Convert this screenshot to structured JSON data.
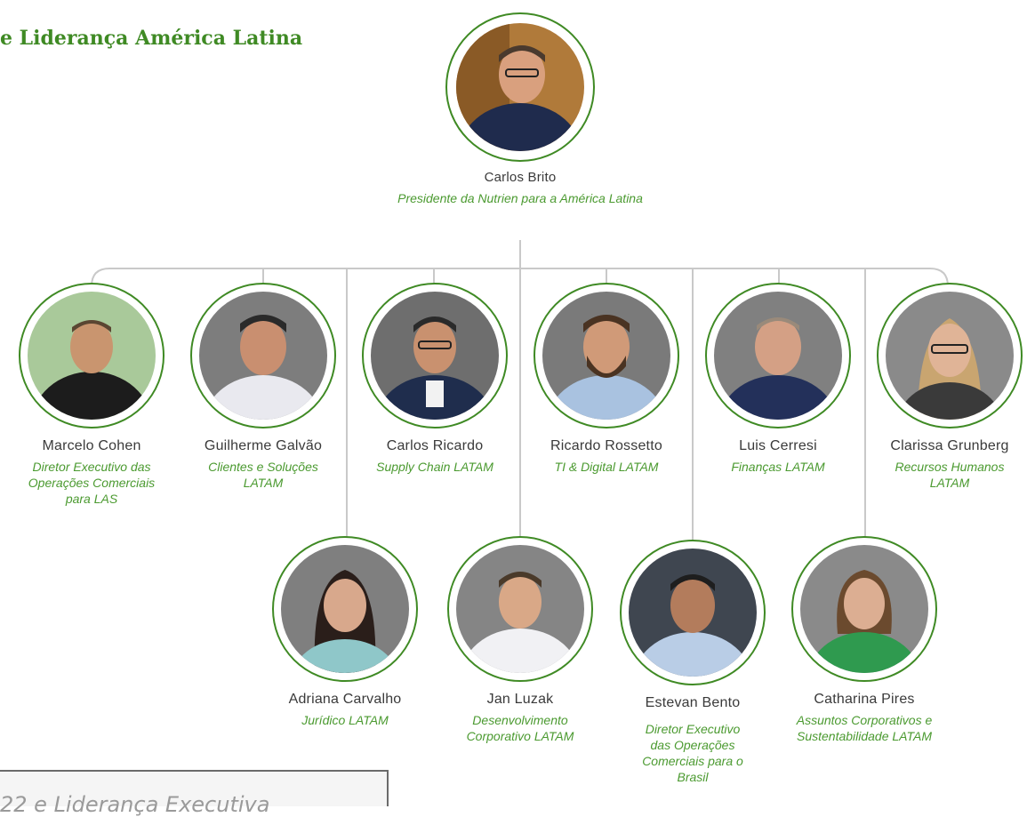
{
  "page_title": "e Liderança América Latina",
  "footer_caption": "22  e Liderança Executiva",
  "accent_color": "#3f8a24",
  "role_color": "#4b9a30",
  "ceo": {
    "name": "Carlos Brito",
    "role": "Presidente da Nutrien para a América Latina"
  },
  "row1": [
    {
      "name": "Marcelo Cohen",
      "role": "Diretor Executivo das Operações Comerciais para LAS"
    },
    {
      "name": "Guilherme Galvão",
      "role": "Clientes e Soluções LATAM"
    },
    {
      "name": "Carlos Ricardo",
      "role": "Supply Chain LATAM"
    },
    {
      "name": "Ricardo Rossetto",
      "role": "TI & Digital LATAM"
    },
    {
      "name": "Luis Cerresi",
      "role": "Finanças LATAM"
    },
    {
      "name": "Clarissa Grunberg",
      "role": "Recursos Humanos LATAM"
    }
  ],
  "row2": [
    {
      "name": "Adriana Carvalho",
      "role": "Jurídico LATAM"
    },
    {
      "name": "Jan Luzak",
      "role": "Desenvolvimento Corporativo LATAM"
    },
    {
      "name": "Estevan Bento",
      "role": "Diretor Executivo das Operações Comerciais para o Brasil"
    },
    {
      "name": "Catharina Pires",
      "role": "Assuntos Corporativos e Sustentabilidade LATAM"
    }
  ]
}
